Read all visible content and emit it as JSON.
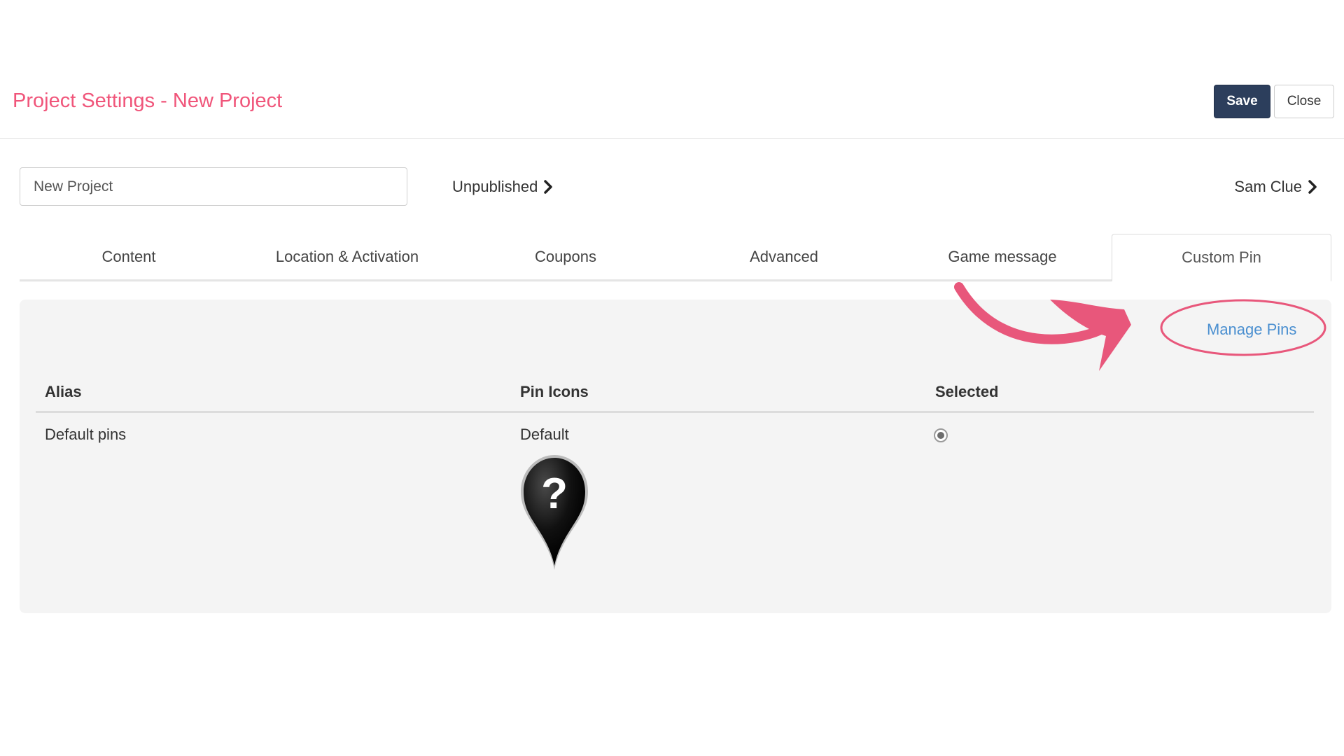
{
  "header": {
    "title": "Project Settings - New Project",
    "save_label": "Save",
    "close_label": "Close"
  },
  "project": {
    "name_value": "New Project",
    "status": "Unpublished",
    "user": "Sam Clue"
  },
  "tabs": [
    {
      "label": "Content",
      "active": false
    },
    {
      "label": "Location & Activation",
      "active": false
    },
    {
      "label": "Coupons",
      "active": false
    },
    {
      "label": "Advanced",
      "active": false
    },
    {
      "label": "Game message",
      "active": false
    },
    {
      "label": "Custom Pin",
      "active": true
    }
  ],
  "custom_pin": {
    "manage_pins_label": "Manage Pins",
    "columns": [
      "Alias",
      "Pin Icons",
      "Selected"
    ],
    "rows": [
      {
        "alias": "Default pins",
        "pin_icon_label": "Default",
        "pin_icon": "question-mark-pin-icon",
        "selected": true
      }
    ]
  },
  "colors": {
    "title": "#f0557a",
    "save_button": "#2c3e5c",
    "link": "#4a8fd0",
    "annotation": "#e8577b"
  }
}
